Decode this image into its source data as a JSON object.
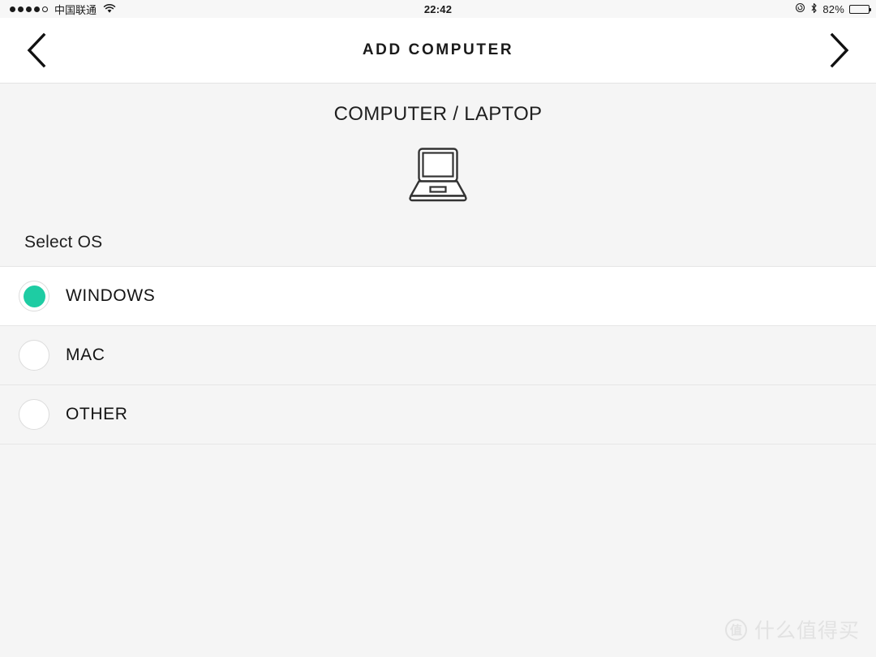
{
  "status_bar": {
    "signal_dots_filled": 4,
    "signal_dots_total": 5,
    "carrier": "中国联通",
    "wifi_icon": "wifi-icon",
    "time": "22:42",
    "rotation_lock_icon": "rotation-lock-icon",
    "bluetooth_icon": "bluetooth-icon",
    "battery_percent": "82%",
    "battery_level": 82
  },
  "nav": {
    "back_icon": "chevron-left-icon",
    "title": "ADD COMPUTER",
    "forward_icon": "chevron-right-icon"
  },
  "main": {
    "device_title": "COMPUTER / LAPTOP",
    "device_icon": "laptop-icon",
    "select_os_label": "Select OS",
    "os_options": [
      {
        "label": "WINDOWS",
        "selected": true
      },
      {
        "label": "MAC",
        "selected": false
      },
      {
        "label": "OTHER",
        "selected": false
      }
    ]
  },
  "watermark": {
    "badge": "值",
    "text": "什么值得买"
  },
  "colors": {
    "accent_green": "#1ecca3",
    "page_background": "#f5f5f5",
    "row_selected_background": "#ffffff",
    "text_primary": "#1a1a1a",
    "divider": "#e6e6e6"
  }
}
